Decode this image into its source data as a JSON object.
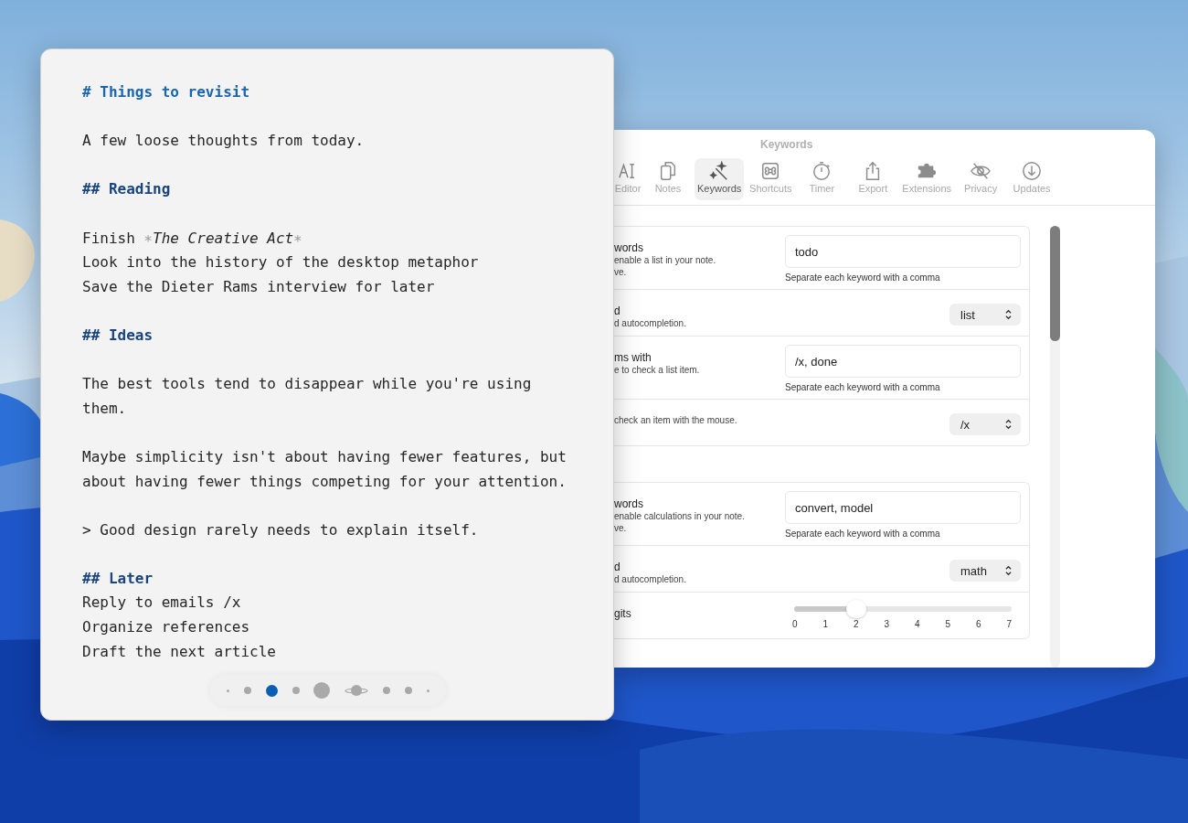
{
  "note_window": {
    "lines": [
      {
        "kind": "h1",
        "text": "# Things to revisit"
      },
      {
        "kind": "blank"
      },
      {
        "kind": "text",
        "text": "A few loose thoughts from today."
      },
      {
        "kind": "blank"
      },
      {
        "kind": "h2",
        "text": "## Reading"
      },
      {
        "kind": "blank"
      },
      {
        "kind": "mixed",
        "parts": [
          {
            "kind": "plain",
            "text": "Finish "
          },
          {
            "kind": "marker",
            "text": "∗"
          },
          {
            "kind": "italic",
            "text": "The Creative Act"
          },
          {
            "kind": "marker",
            "text": "∗"
          }
        ]
      },
      {
        "kind": "text",
        "text": "Look into the history of the desktop metaphor"
      },
      {
        "kind": "text",
        "text": "Save the Dieter Rams interview for later"
      },
      {
        "kind": "blank"
      },
      {
        "kind": "h2",
        "text": "## Ideas"
      },
      {
        "kind": "blank"
      },
      {
        "kind": "text",
        "text": "The best tools tend to disappear while you're using them."
      },
      {
        "kind": "blank"
      },
      {
        "kind": "text",
        "text": "Maybe simplicity isn't about having fewer features, but about having fewer things competing for your attention."
      },
      {
        "kind": "blank"
      },
      {
        "kind": "text",
        "text": "> Good design rarely needs to explain itself."
      },
      {
        "kind": "blank"
      },
      {
        "kind": "h2",
        "text": "## Later"
      },
      {
        "kind": "text",
        "text": "Reply to emails /x"
      },
      {
        "kind": "text",
        "text": "Organize references"
      },
      {
        "kind": "text",
        "text": "Draft the next article"
      }
    ],
    "page_dots": [
      {
        "kind": "tiny",
        "selected": false
      },
      {
        "kind": "small",
        "selected": false
      },
      {
        "kind": "medium",
        "selected": true
      },
      {
        "kind": "small",
        "selected": false
      },
      {
        "kind": "large",
        "selected": false
      },
      {
        "kind": "ringed",
        "selected": false
      },
      {
        "kind": "small",
        "selected": false
      },
      {
        "kind": "small",
        "selected": false
      },
      {
        "kind": "tiny",
        "selected": false
      }
    ]
  },
  "settings_window": {
    "title": "Keywords",
    "toolbar": [
      {
        "kind": "text",
        "label": "Editor",
        "selected": false
      },
      {
        "kind": "notes",
        "label": "Notes",
        "selected": false
      },
      {
        "kind": "wand",
        "label": "Keywords",
        "selected": true
      },
      {
        "kind": "command",
        "label": "Shortcuts",
        "selected": false
      },
      {
        "kind": "timer",
        "label": "Timer",
        "selected": false
      },
      {
        "kind": "share",
        "label": "Export",
        "selected": false
      },
      {
        "kind": "puzzle",
        "label": "Extensions",
        "selected": false
      },
      {
        "kind": "eye",
        "label": "Privacy",
        "selected": false
      },
      {
        "kind": "download",
        "label": "Updates",
        "selected": false
      }
    ],
    "groups": [
      {
        "rows": [
          {
            "kind": "field",
            "title": "words",
            "description": [
              "enable a list in your note.",
              "ve."
            ],
            "value": "todo",
            "helper": "Separate each keyword with a comma"
          },
          {
            "kind": "select",
            "title": "d",
            "description": [
              "d autocompletion."
            ],
            "value": "list"
          },
          {
            "kind": "field",
            "title": "ms with",
            "description": [
              "e to check a list item."
            ],
            "value": "/x, done",
            "helper": "Separate each keyword with a comma"
          },
          {
            "kind": "select",
            "description": [
              "check an item with the mouse."
            ],
            "value": "/x"
          }
        ]
      },
      {
        "rows": [
          {
            "kind": "field",
            "title": "words",
            "description": [
              "enable calculations in your note.",
              "ve."
            ],
            "value": "convert, model",
            "helper": "Separate each keyword with a comma"
          },
          {
            "kind": "select",
            "title": "d",
            "description": [
              "d autocompletion."
            ],
            "value": "math"
          },
          {
            "kind": "slider",
            "title": "gits",
            "level": 0.2857,
            "ticks": [
              "0",
              "1",
              "2",
              "3",
              "4",
              "5",
              "6",
              "7"
            ]
          }
        ]
      }
    ]
  }
}
